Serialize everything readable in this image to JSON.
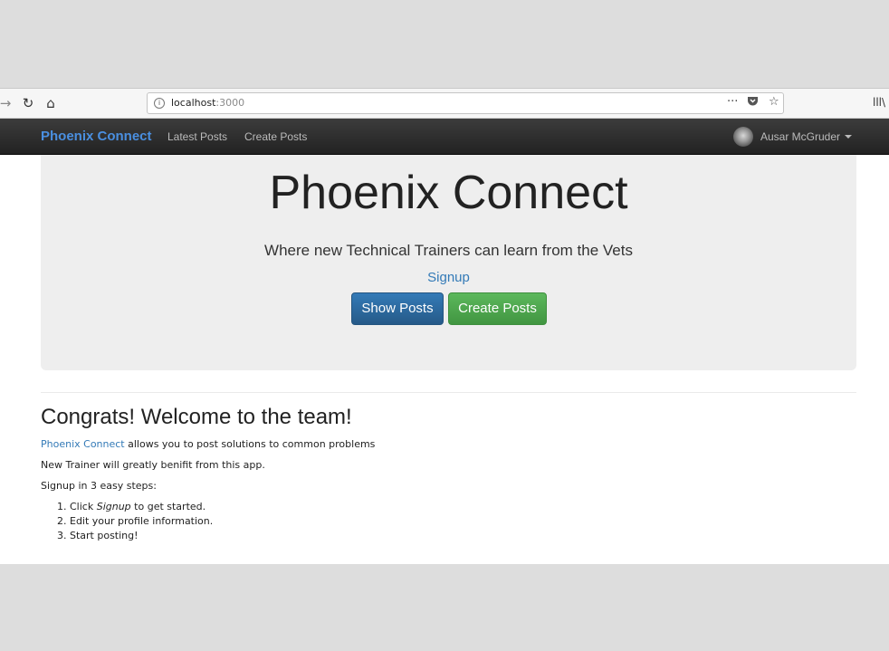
{
  "browser": {
    "url_host": "localhost",
    "url_port": ":3000"
  },
  "navbar": {
    "brand": "Phoenix Connect",
    "links": [
      "Latest Posts",
      "Create Posts"
    ],
    "user_name": "Ausar McGruder"
  },
  "jumbotron": {
    "title": "Phoenix Connect",
    "subtitle": "Where new Technical Trainers can learn from the Vets",
    "signup_link": "Signup",
    "show_posts_button": "Show Posts",
    "create_posts_button": "Create Posts"
  },
  "content": {
    "heading": "Congrats! Welcome to the team!",
    "intro_link": "Phoenix Connect",
    "intro_rest": " allows you to post solutions to common problems",
    "benefit": "New Trainer will greatly benifit from this app.",
    "steps_intro": "Signup in 3 easy steps:",
    "step1_prefix": "Click ",
    "step1_em": "Signup",
    "step1_suffix": " to get started.",
    "step2": "Edit your profile information.",
    "step3": "Start posting!"
  },
  "icons": {
    "back": "back-arrow-icon",
    "reload": "reload-icon",
    "home": "home-icon",
    "info": "info-icon",
    "more": "more-icon",
    "pocket": "pocket-icon",
    "bookmark": "bookmark-star-icon",
    "library": "library-icon"
  }
}
